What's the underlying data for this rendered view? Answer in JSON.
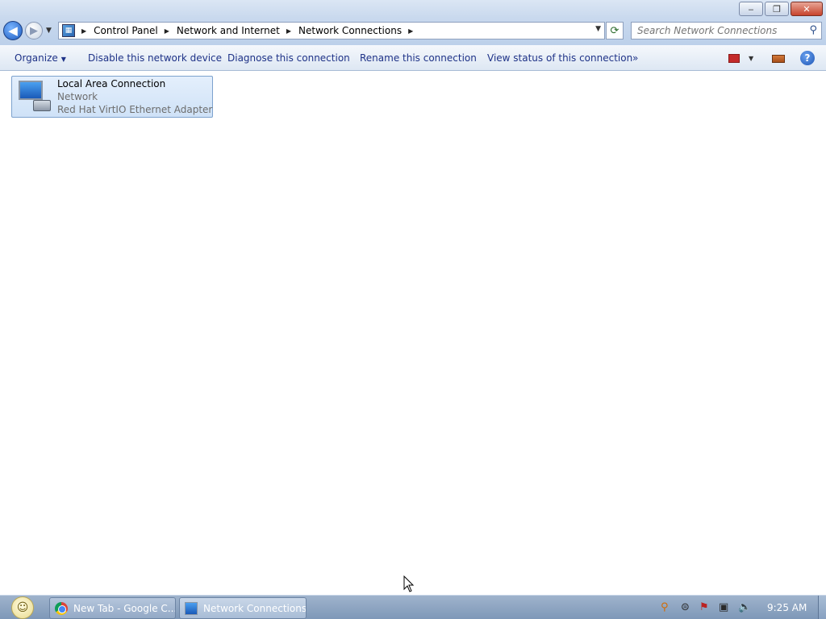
{
  "window": {
    "minimize_label": "‒",
    "restore_label": "❐",
    "close_label": "✕"
  },
  "address": {
    "back_label": "◀",
    "forward_label": "▶",
    "breadcrumbs": [
      "Control Panel",
      "Network and Internet",
      "Network Connections"
    ],
    "refresh_label": "⟳",
    "search_placeholder": "Search Network Connections"
  },
  "commands": {
    "organize": "Organize",
    "disable": "Disable this network device",
    "diagnose": "Diagnose this connection",
    "rename": "Rename this connection",
    "view_status": "View status of this connection",
    "more": "»",
    "help": "?"
  },
  "connection": {
    "name": "Local Area Connection",
    "network": "Network",
    "adapter": "Red Hat VirtIO Ethernet Adapter"
  },
  "taskbar": {
    "tasks": [
      "New Tab - Google C...",
      "Network Connections"
    ],
    "clock": "9:25 AM"
  },
  "colors": {
    "link": "#1e3287",
    "selection": "#cfe2f7",
    "taskbar": "#8aa2c0"
  }
}
